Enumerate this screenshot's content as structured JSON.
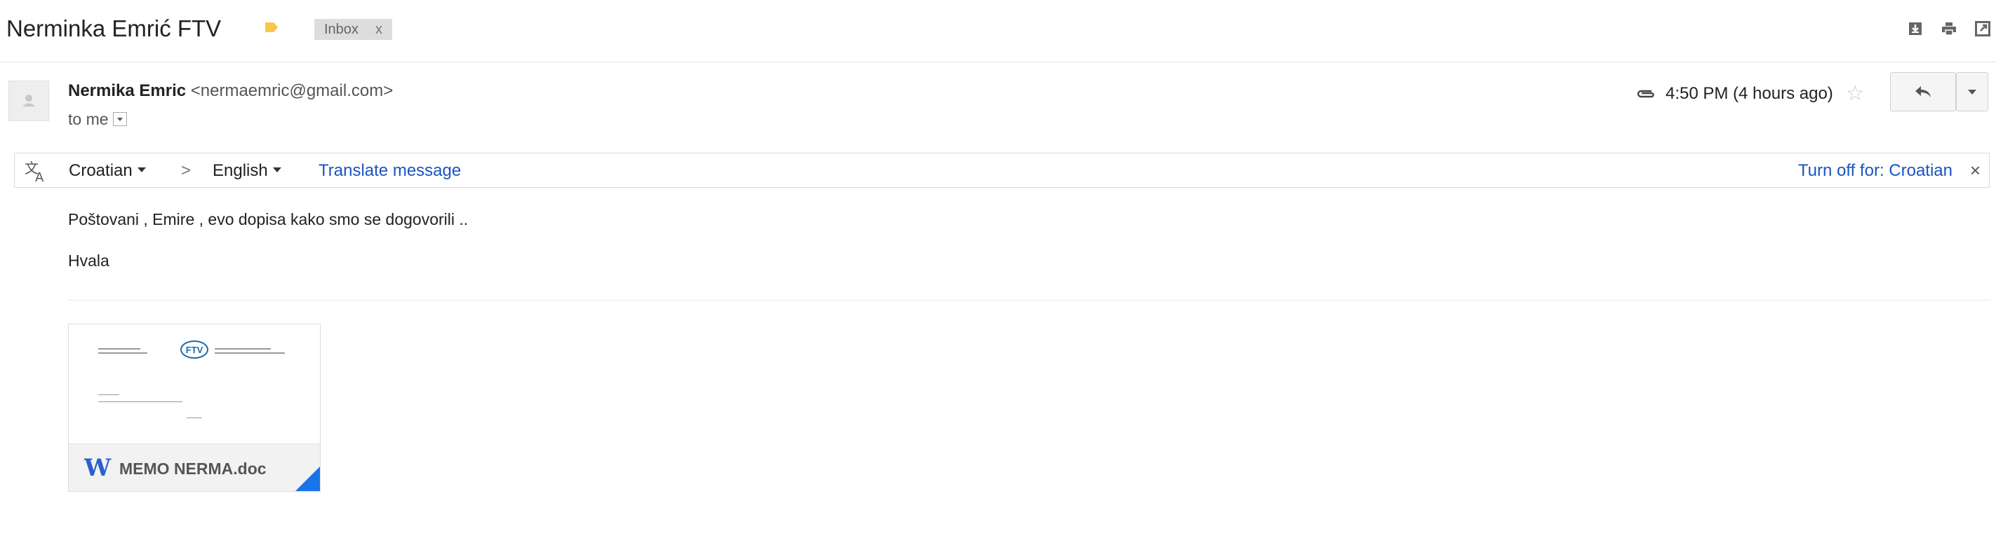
{
  "thread": {
    "subject": "Nerminka Emrić FTV",
    "label": "Inbox",
    "label_close": "x"
  },
  "message": {
    "sender_name": "Nermika Emric",
    "sender_email": "<nermaemric@gmail.com>",
    "recipient": "to me",
    "time": "4:50 PM (4 hours ago)"
  },
  "translate": {
    "source_lang": "Croatian",
    "arrow": ">",
    "target_lang": "English",
    "action": "Translate message",
    "turn_off": "Turn off for: Croatian",
    "close": "×"
  },
  "body": {
    "line1": "Poštovani , Emire , evo dopisa kako smo se dogovorili ..",
    "line2": "Hvala"
  },
  "attachment": {
    "filename": "MEMO NERMA.doc",
    "icon_letter": "W",
    "preview_logo": "FTV"
  },
  "colors": {
    "link": "#1a55c0",
    "label_tag": "#f7c64a",
    "doc_accent": "#1a73e8"
  }
}
